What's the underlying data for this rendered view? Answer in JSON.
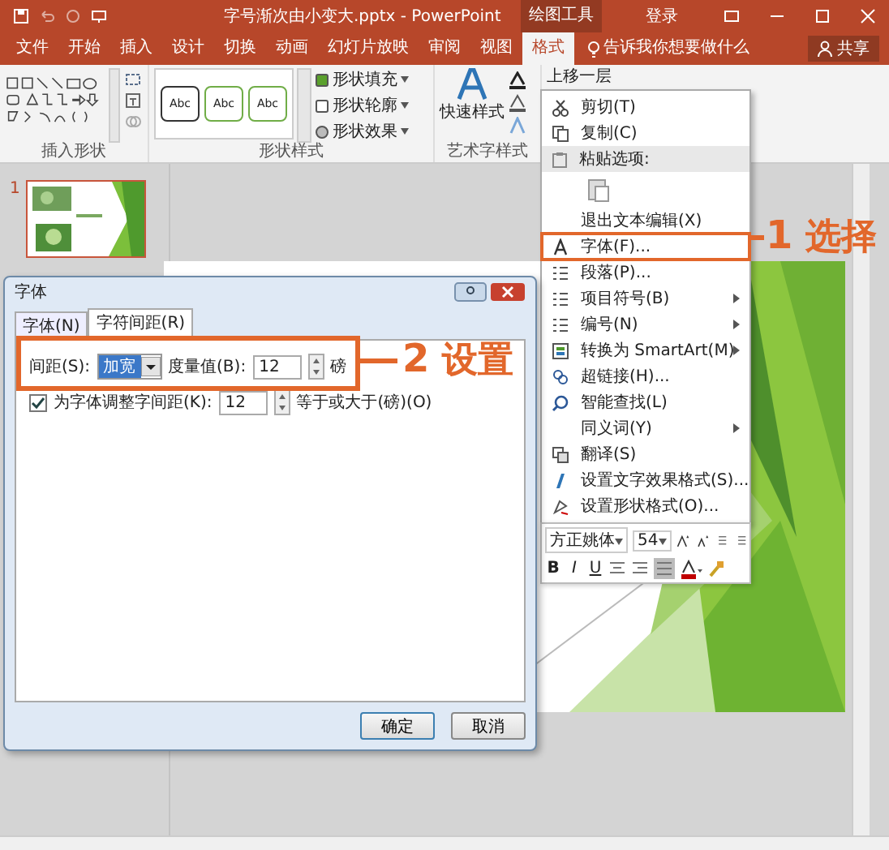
{
  "window": {
    "title": "字号渐次由小变大.pptx - PowerPoint",
    "context_group": "绘图工具",
    "sign_in": "登录"
  },
  "ribbon_tabs": [
    {
      "label": "文件",
      "selected": false
    },
    {
      "label": "开始",
      "selected": false
    },
    {
      "label": "插入",
      "selected": false
    },
    {
      "label": "设计",
      "selected": false
    },
    {
      "label": "切换",
      "selected": false
    },
    {
      "label": "动画",
      "selected": false
    },
    {
      "label": "幻灯片放映",
      "selected": false
    },
    {
      "label": "审阅",
      "selected": false
    },
    {
      "label": "视图",
      "selected": false
    },
    {
      "label": "格式",
      "selected": true
    }
  ],
  "tell_me": "告诉我你想要做什么",
  "share": "共享",
  "ribbon": {
    "insert_shapes": "插入形状",
    "shape_styles": {
      "label": "形状样式",
      "samples": [
        "Abc",
        "Abc",
        "Abc"
      ],
      "commands": [
        "形状填充",
        "形状轮廓",
        "形状效果"
      ]
    },
    "wordart": {
      "label": "艺术字样式",
      "quick_styles": "快速样式"
    },
    "arrange": "上移一层"
  },
  "slides": [
    {
      "number": "1",
      "selected": true
    }
  ],
  "context_menu": [
    {
      "kind": "command",
      "label": "剪切(T)",
      "submenu": false,
      "callout": false
    },
    {
      "kind": "command",
      "label": "复制(C)",
      "submenu": false,
      "callout": false
    },
    {
      "kind": "header",
      "label": "粘贴选项:"
    },
    {
      "kind": "paste"
    },
    {
      "kind": "command",
      "label": "退出文本编辑(X)",
      "submenu": false,
      "callout": false
    },
    {
      "kind": "command",
      "label": "字体(F)...",
      "submenu": false,
      "callout": true
    },
    {
      "kind": "command",
      "label": "段落(P)...",
      "submenu": false,
      "callout": false
    },
    {
      "kind": "command",
      "label": "项目符号(B)",
      "submenu": true,
      "callout": false
    },
    {
      "kind": "command",
      "label": "编号(N)",
      "submenu": true,
      "callout": false
    },
    {
      "kind": "command",
      "label": "转换为 SmartArt(M)",
      "submenu": true,
      "callout": false
    },
    {
      "kind": "command",
      "label": "超链接(H)...",
      "submenu": false,
      "callout": false
    },
    {
      "kind": "command",
      "label": "智能查找(L)",
      "submenu": false,
      "callout": false
    },
    {
      "kind": "command",
      "label": "同义词(Y)",
      "submenu": true,
      "callout": false
    },
    {
      "kind": "command",
      "label": "翻译(S)",
      "submenu": false,
      "callout": false
    },
    {
      "kind": "command",
      "label": "设置文字效果格式(S)...",
      "submenu": false,
      "callout": false
    },
    {
      "kind": "command",
      "label": "设置形状格式(O)...",
      "submenu": false,
      "callout": false
    }
  ],
  "mini_toolbar": {
    "font": "方正姚体",
    "size": "54",
    "bold": "B",
    "italic": "I",
    "underline": "U"
  },
  "dialog": {
    "title": "字体",
    "tabs": [
      {
        "label": "字体(N)",
        "selected": false
      },
      {
        "label": "字符间距(R)",
        "selected": true
      }
    ],
    "spacing_label": "间距(S):",
    "spacing": "加宽",
    "amount_label": "度量值(B):",
    "amount": "12",
    "unit": "磅",
    "kerning": {
      "checked": true,
      "label": "为字体调整字间距(K):",
      "value": "12",
      "suffix": "等于或大于(磅)(O)"
    },
    "buttons": [
      "确定",
      "取消"
    ]
  },
  "annotations": [
    {
      "number": "1",
      "text": "选择"
    },
    {
      "number": "2",
      "text": "设置"
    }
  ]
}
